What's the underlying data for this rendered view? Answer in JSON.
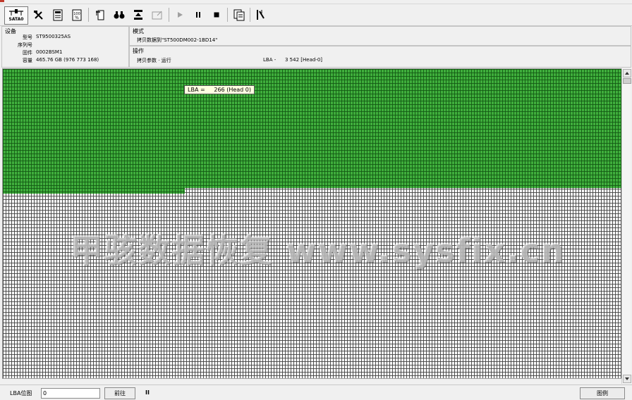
{
  "toolbar": {
    "sata_label": "SATA0",
    "buttons": [
      "sata0",
      "tools",
      "sector-info",
      "percent",
      "file-tools",
      "search",
      "copy",
      "open",
      "play",
      "pause",
      "stop",
      "copy-log",
      "parallel"
    ]
  },
  "device": {
    "title": "设备",
    "model_label": "型号",
    "model_value": "ST9500325AS",
    "serial_label": "序列号",
    "serial_value": "",
    "firmware_label": "固件",
    "firmware_value": "0002BSM1",
    "capacity_label": "容量",
    "capacity_value": "465.76 GB (976 773 168)"
  },
  "mode": {
    "title": "模式",
    "value": "拷贝数据到\"ST500DM002-1BD14\""
  },
  "operation": {
    "title": "操作",
    "value": "拷贝参数 · 运行",
    "lba_label": "LBA -",
    "lba_value": "3 542  [Head-0]"
  },
  "map": {
    "tooltip": "LBA =     266 (Head 0)",
    "watermark": "甲骇数据恢复  www.sysfix.cn",
    "colors": {
      "done": "#3fae3c",
      "pending": "#ffffff",
      "grid": "#464646"
    }
  },
  "statusbar": {
    "lba_pos_label": "LBA位图",
    "lba_input_value": "0",
    "goto_label": "前往",
    "pause_label": "II",
    "legend_label": "图例"
  }
}
